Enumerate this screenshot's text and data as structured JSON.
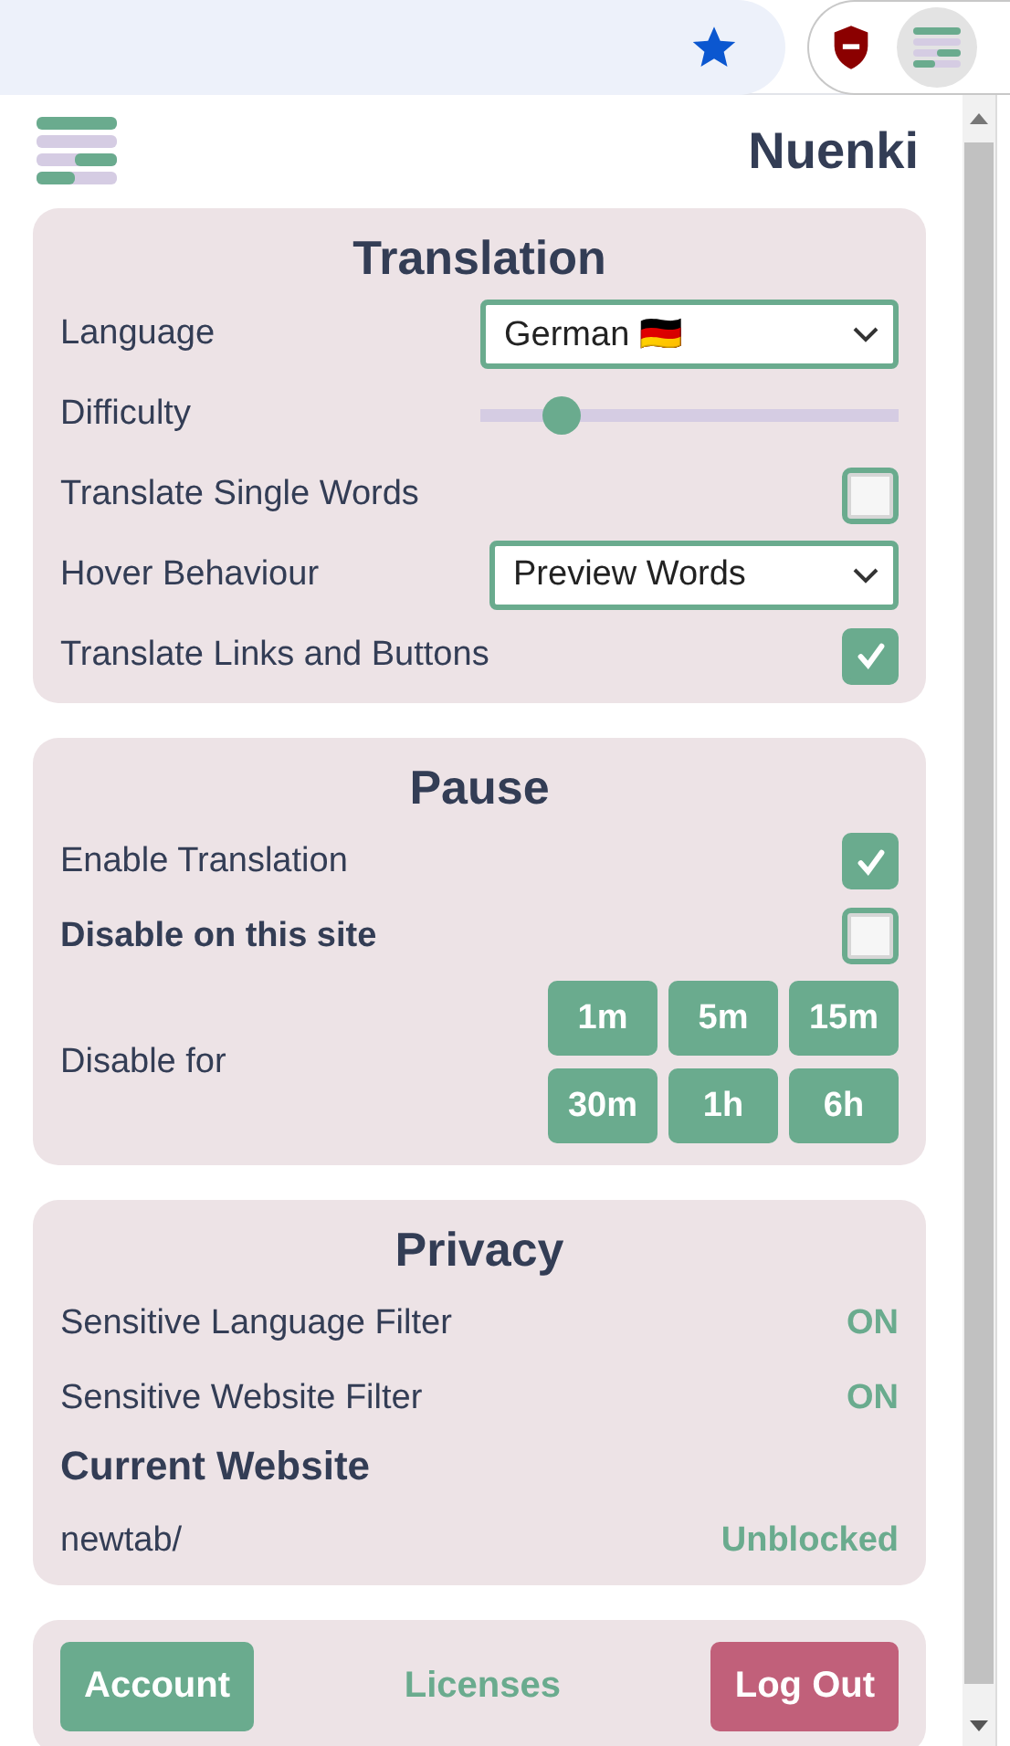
{
  "header": {
    "title": "Nuenki"
  },
  "translation": {
    "title": "Translation",
    "rows": [
      {
        "kind": "select",
        "label": "Language",
        "value": "German 🇩🇪"
      },
      {
        "kind": "slider",
        "label": "Difficulty",
        "level": 0.19
      },
      {
        "kind": "checkbox",
        "label": "Translate Single Words",
        "checked": false
      },
      {
        "kind": "select",
        "label": "Hover Behaviour",
        "value": "Preview Words"
      },
      {
        "kind": "checkbox",
        "label": "Translate Links and Buttons",
        "checked": true
      }
    ]
  },
  "pause": {
    "title": "Pause",
    "rows": [
      {
        "kind": "checkbox",
        "label": "Enable Translation",
        "emphasis": false,
        "checked": true
      },
      {
        "kind": "checkbox",
        "label": "Disable on this site",
        "emphasis": true,
        "checked": false
      }
    ],
    "disable_for": {
      "label": "Disable for",
      "buttons": [
        "1m",
        "5m",
        "15m",
        "30m",
        "1h",
        "6h"
      ]
    }
  },
  "privacy": {
    "title": "Privacy",
    "rows": [
      {
        "label": "Sensitive Language Filter",
        "value": "ON"
      },
      {
        "label": "Sensitive Website Filter",
        "value": "ON"
      }
    ],
    "current_website": {
      "title": "Current Website",
      "site": "newtab/",
      "status": "Unblocked"
    }
  },
  "footer": {
    "buttons": [
      {
        "kind": "primary",
        "label": "Account"
      },
      {
        "kind": "link",
        "label": "Licenses"
      },
      {
        "kind": "danger",
        "label": "Log Out"
      }
    ]
  }
}
